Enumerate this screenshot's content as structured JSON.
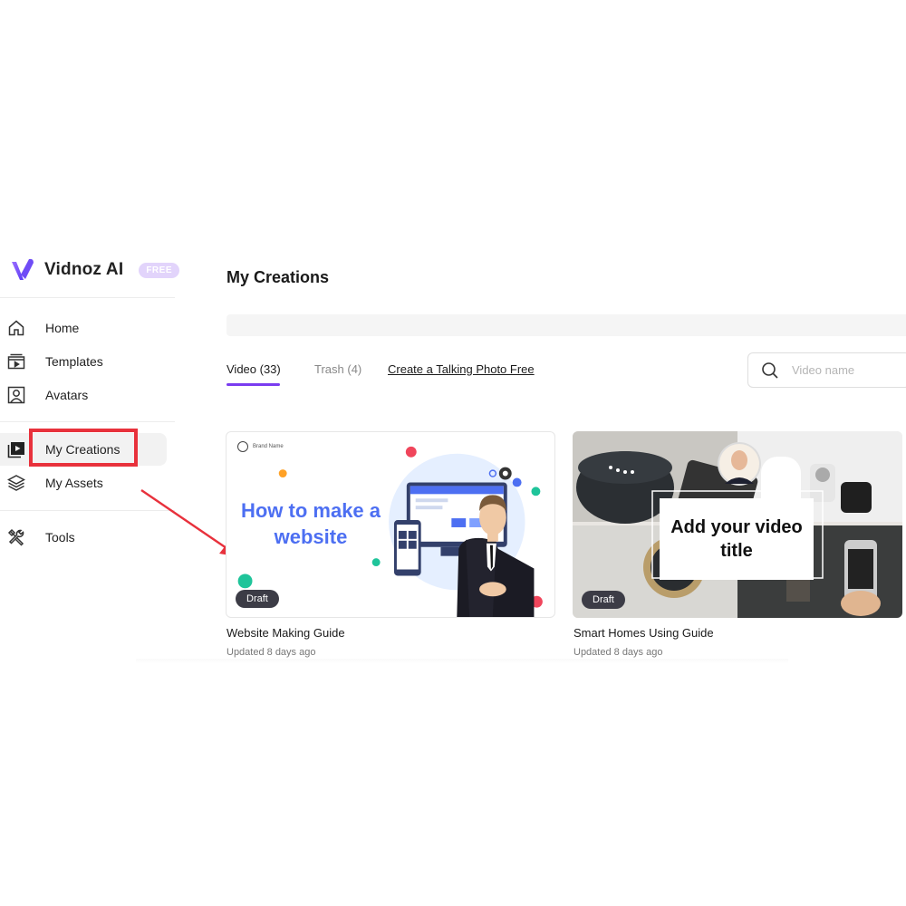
{
  "brand": {
    "name": "Vidnoz AI",
    "badge": "FREE",
    "accent": "#7a3cf0"
  },
  "sidebar": {
    "items": [
      {
        "label": "Home",
        "icon": "home-icon"
      },
      {
        "label": "Templates",
        "icon": "templates-icon"
      },
      {
        "label": "Avatars",
        "icon": "avatar-icon"
      },
      {
        "label": "My Creations",
        "icon": "play-library-icon",
        "active": true
      },
      {
        "label": "My Assets",
        "icon": "layers-icon"
      },
      {
        "label": "Tools",
        "icon": "tools-icon"
      }
    ]
  },
  "main": {
    "title": "My Creations",
    "tabs": [
      {
        "label": "Video (33)",
        "active": true
      },
      {
        "label": "Trash (4)",
        "active": false
      }
    ],
    "talking_photo_link": "Create a Talking Photo Free",
    "search": {
      "placeholder": "Video name",
      "value": ""
    },
    "videos": [
      {
        "name": "Website Making Guide",
        "updated": "Updated 8 days ago",
        "status": "Draft",
        "thumb_text": "How to make a website",
        "thumb_brand": "Brand Name"
      },
      {
        "name": "Smart Homes Using Guide",
        "updated": "Updated 8 days ago",
        "status": "Draft",
        "thumb_text": "Add your video title"
      }
    ]
  },
  "annotation": {
    "highlight_color": "#e8313c"
  }
}
